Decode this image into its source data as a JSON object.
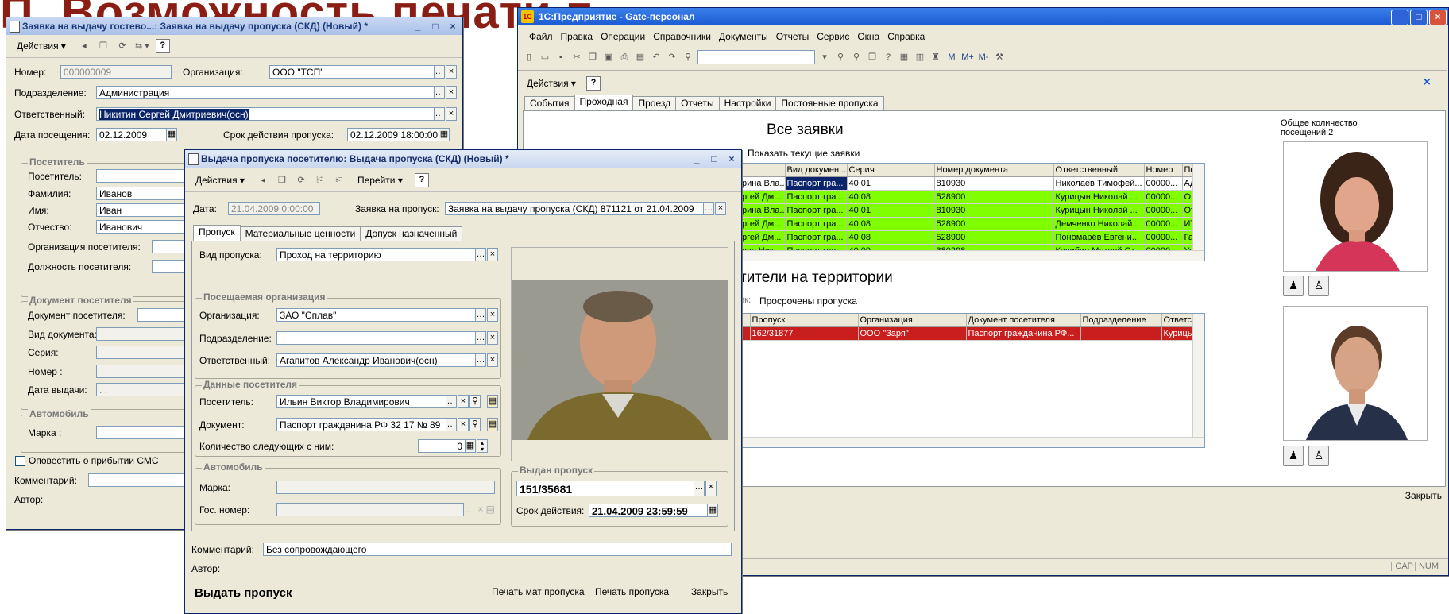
{
  "slide": {
    "title": "П. Возможность печати п"
  },
  "guest_form": {
    "title": "Заявка на выдачу гостево...: Заявка на выдачу пропуска (СКД) (Новый) *",
    "actions_label": "Действия",
    "help_label": "?",
    "number_label": "Номер:",
    "number_value": "000000009",
    "org_label": "Организация:",
    "org_value": "ООО \"ТСП\"",
    "dept_label": "Подразделение:",
    "dept_value": "Администрация",
    "resp_label": "Ответственный:",
    "resp_value": "Никитин Сергей Дмитриевич(осн)",
    "visit_date_label": "Дата посещения:",
    "visit_date_value": "02.12.2009",
    "validity_label": "Срок действия пропуска:",
    "validity_value": "02.12.2009 18:00:00",
    "visitor_group": "Посетитель",
    "visitor_label": "Посетитель:",
    "surname_label": "Фамилия:",
    "surname_value": "Иванов",
    "name_label": "Имя:",
    "name_value": "Иван",
    "patronymic_label": "Отчество:",
    "patronymic_value": "Иванович",
    "visitor_org_label": "Организация посетителя:",
    "visitor_pos_label": "Должность посетителя:",
    "doc_group": "Документ посетителя",
    "doc_label": "Документ посетителя:",
    "doc_type_label": "Вид документа:",
    "series_label": "Серия:",
    "doc_number_label": "Номер :",
    "issue_date_label": "Дата выдачи:",
    "issue_date_value": ". .",
    "car_group": "Автомобиль",
    "brand_label": "Марка :",
    "sms_label": "Оповестить о прибытии СМС",
    "comment_label": "Комментарий:",
    "author_label": "Автор:"
  },
  "main_window": {
    "title": "1С:Предприятие - Gate-персонал",
    "app_icon": "1С",
    "menu": [
      "Файл",
      "Правка",
      "Операции",
      "Справочники",
      "Документы",
      "Отчеты",
      "Сервис",
      "Окна",
      "Справка"
    ],
    "toolbar_extra": [
      "M",
      "M+",
      "M-"
    ],
    "actions_label": "Действия",
    "help_label": "?",
    "close_label": "×",
    "tabs": [
      "События",
      "Проходная",
      "Проезд",
      "Отчеты",
      "Настройки",
      "Постоянные пропуска"
    ],
    "requests_title": "Все заявки",
    "show_current_label": "Показать текущие заявки",
    "requests_columns": [
      "",
      "Вид докумен...",
      "Серия",
      "Номер документа",
      "Ответственный",
      "Номер",
      "Подразделение"
    ],
    "requests_rows": [
      {
        "style": "w",
        "cells": [
          "рина Вла...",
          "Паспорт гра...",
          "40 01",
          "810930",
          "Николаев Тимофей...",
          "00000...",
          "Администрация"
        ]
      },
      {
        "style": "g",
        "cells": [
          "ргей Дм...",
          "Паспорт гра...",
          "40 08",
          "528900",
          "Курицын Николай ...",
          "00000...",
          "Отдел сбыта"
        ]
      },
      {
        "style": "g",
        "cells": [
          "рина Вла...",
          "Паспорт гра...",
          "40 01",
          "810930",
          "Курицын Николай ...",
          "00000...",
          "Отдел сбыта"
        ]
      },
      {
        "style": "g",
        "cells": [
          "ргей Дм...",
          "Паспорт гра...",
          "40 08",
          "528900",
          "Демченко Николай...",
          "00000...",
          "ИТР"
        ]
      },
      {
        "style": "g",
        "cells": [
          "ргей Дм...",
          "Паспорт гра...",
          "40 08",
          "528900",
          "Пономарёв Евгени...",
          "00000...",
          "Гальванический уч"
        ]
      },
      {
        "style": "g",
        "cells": [
          "ван Ник...",
          "Паспорт гра...",
          "40 09",
          "380298",
          "Кулибин Матвей Ст...",
          "00000...",
          "Управление"
        ]
      }
    ],
    "visits_label": "Общее количество посещений 2",
    "visitors_title": "тители на территории",
    "expired_prefix": "ик:",
    "expired_label": "Просрочены пропуска",
    "visitors_columns": [
      "",
      "Пропуск",
      "Организация",
      "Документ посетителя",
      "Подразделение",
      "Ответственный"
    ],
    "visitors_rows": [
      {
        "style": "r",
        "cells": [
          "",
          "162/31877",
          "ООО \"Заря\"",
          "Паспорт гражданина РФ...",
          "",
          "Курицын Николай Пе..."
        ]
      }
    ],
    "close_button": "Закрыть",
    "status": [
      "CAP",
      "NUM"
    ]
  },
  "issue_form": {
    "title": "Выдача пропуска посетителю: Выдача пропуска (СКД) (Новый) *",
    "actions_label": "Действия",
    "goto_label": "Перейти",
    "help_label": "?",
    "date_label": "Дата:",
    "date_value": "21.04.2009 0:00:00",
    "request_label": "Заявка на пропуск:",
    "request_value": "Заявка на выдачу пропуска (СКД) 871121 от 21.04.2009",
    "tabs": [
      "Пропуск",
      "Материальные ценности",
      "Допуск назначенный"
    ],
    "pass_type_label": "Вид пропуска:",
    "pass_type_value": "Проход на территорию",
    "visited_org_group": "Посещаемая организация",
    "org_label": "Организация:",
    "org_value": "ЗАО \"Сплав\"",
    "dept_label": "Подразделение:",
    "resp_label": "Ответственный:",
    "resp_value": "Агапитов Александр Иванович(осн)",
    "visitor_data_group": "Данные посетителя",
    "visitor_label": "Посетитель:",
    "visitor_value": "Ильин Виктор Владимирович",
    "document_label": "Документ:",
    "document_value": "Паспорт гражданина РФ 32 17 № 89",
    "companions_label": "Количество следующих с ним:",
    "companions_value": "0",
    "car_group": "Автомобиль",
    "brand_label": "Марка:",
    "plate_label": "Гос. номер:",
    "issued_group": "Выдан пропуск",
    "pass_number": "151/35681",
    "validity_label": "Срок действия:",
    "validity_value": "21.04.2009 23:59:59",
    "comment_label": "Комментарий:",
    "comment_value": "Без сопровождающего",
    "author_label": "Автор:",
    "footer_title": "Выдать пропуск",
    "print_mat_button": "Печать мат пропуска",
    "print_pass_button": "Печать пропуска",
    "close_button": "Закрыть"
  }
}
